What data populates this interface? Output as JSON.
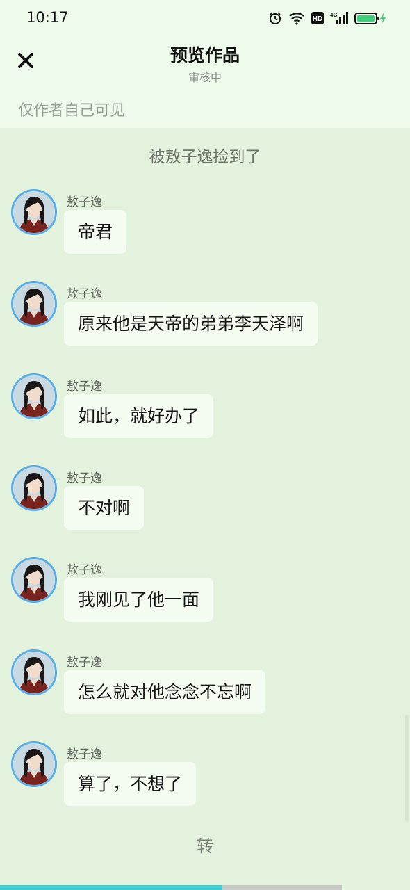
{
  "status_bar": {
    "time": "10:17",
    "icons": [
      "alarm-icon",
      "wifi-icon",
      "hd-icon",
      "4g-signal-icon",
      "battery-charging-icon"
    ],
    "hd_label": "HD",
    "network_label": "4G",
    "battery_color": "#3ecf7a"
  },
  "header": {
    "title": "预览作品",
    "subtitle": "审核中",
    "visibility_note": "仅作者自己可见",
    "close_icon": "close-icon"
  },
  "chapter": {
    "title": "被敖子逸捡到了"
  },
  "messages": [
    {
      "sender": "敖子逸",
      "text": "帝君"
    },
    {
      "sender": "敖子逸",
      "text": "原来他是天帝的弟弟李天泽啊"
    },
    {
      "sender": "敖子逸",
      "text": "如此，就好办了"
    },
    {
      "sender": "敖子逸",
      "text": "不对啊"
    },
    {
      "sender": "敖子逸",
      "text": "我刚见了他一面"
    },
    {
      "sender": "敖子逸",
      "text": "怎么就对他念念不忘啊"
    },
    {
      "sender": "敖子逸",
      "text": "算了，不想了"
    }
  ],
  "footer": {
    "continue_label": "转",
    "reading_progress": 0.65
  },
  "colors": {
    "background": "#e3f2dc",
    "header_background": "#eefbea",
    "bubble": "#f4fbf1",
    "avatar_ring": "#5aaee6",
    "progress": "#3fcfd6"
  }
}
